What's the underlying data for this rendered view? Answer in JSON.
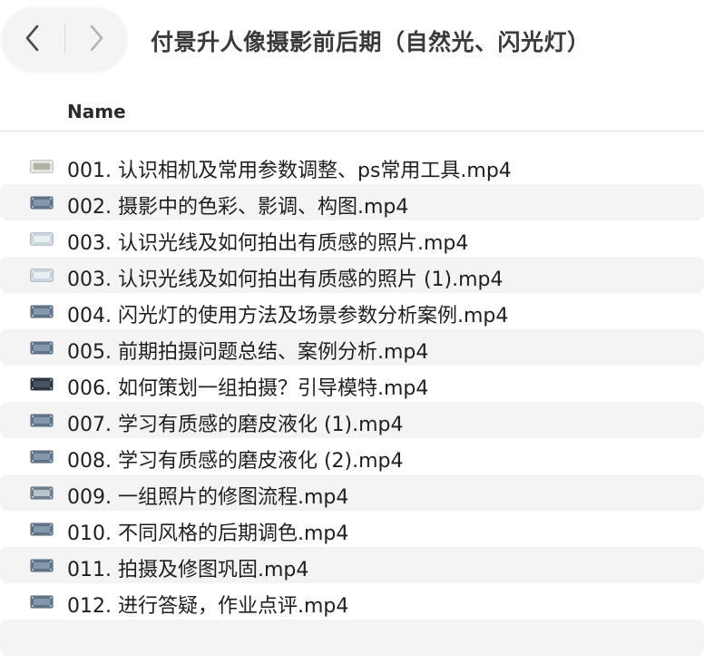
{
  "toolbar": {
    "back_icon": "chevron-left-icon",
    "forward_icon": "chevron-right-icon",
    "title": "付景升人像摄影前后期（自然光、闪光灯）"
  },
  "columns": {
    "name": "Name"
  },
  "files": [
    {
      "name": "001.  认识相机及常用参数调整、ps常用工具.mp4",
      "thumb": "light"
    },
    {
      "name": "002.  摄影中的色彩、影调、构图.mp4",
      "thumb": "blue"
    },
    {
      "name": "003.  认识光线及如何拍出有质感的照片.mp4",
      "thumb": "pale"
    },
    {
      "name": "003.  认识光线及如何拍出有质感的照片 (1).mp4",
      "thumb": "pale"
    },
    {
      "name": "004.  闪光灯的使用方法及场景参数分析案例.mp4",
      "thumb": "blue"
    },
    {
      "name": "005.  前期拍摄问题总结、案例分析.mp4",
      "thumb": "blue"
    },
    {
      "name": "006.  如何策划一组拍摄？引导模特.mp4",
      "thumb": "dark"
    },
    {
      "name": "007.  学习有质感的磨皮液化 (1).mp4",
      "thumb": "blue"
    },
    {
      "name": "008.  学习有质感的磨皮液化 (2).mp4",
      "thumb": "blue"
    },
    {
      "name": "009.  一组照片的修图流程.mp4",
      "thumb": "mixed"
    },
    {
      "name": "010.  不同风格的后期调色.mp4",
      "thumb": "blue"
    },
    {
      "name": "011.  拍摄及修图巩固.mp4",
      "thumb": "blue"
    },
    {
      "name": "012.  进行答疑，作业点评.mp4",
      "thumb": "blue"
    }
  ],
  "colors": {
    "row_alt": "#f4f4f4",
    "thumb_blue": "#5f7587",
    "thumb_dark": "#2b3540",
    "thumb_pale": "#c9d3dc",
    "thumb_light": "#e3e3dc"
  }
}
